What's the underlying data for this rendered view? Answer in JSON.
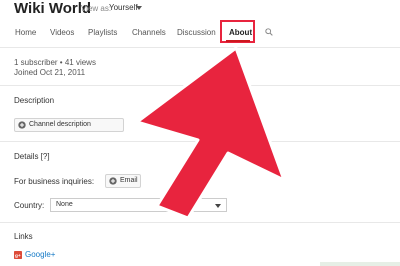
{
  "header": {
    "channel_title": "Wiki World",
    "view_as_label": "View as:",
    "view_as_value": "Yourself"
  },
  "tabs": [
    {
      "label": "Home"
    },
    {
      "label": "Videos"
    },
    {
      "label": "Playlists"
    },
    {
      "label": "Channels"
    },
    {
      "label": "Discussion"
    },
    {
      "label": "About"
    }
  ],
  "stats": {
    "line": "1 subscriber • 41 views",
    "joined": "Joined Oct 21, 2011"
  },
  "description": {
    "heading": "Description",
    "button_label": "Channel description"
  },
  "details": {
    "heading": "Details [?]",
    "business_label": "For business inquiries:",
    "email_button": "Email",
    "country_label": "Country:",
    "country_value": "None"
  },
  "links": {
    "heading": "Links",
    "google_plus": "Google+"
  },
  "colors": {
    "highlight": "#e8243e",
    "link": "#167ac6"
  }
}
